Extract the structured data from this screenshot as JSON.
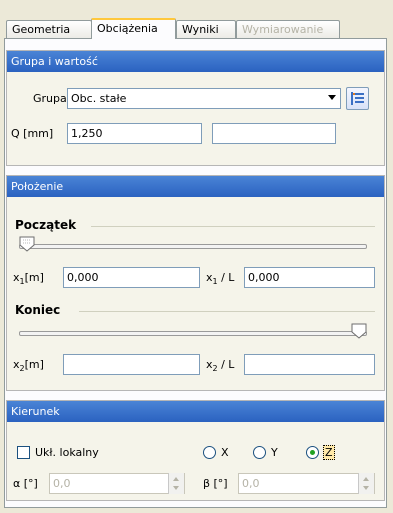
{
  "tabs": {
    "geometria": "Geometria",
    "obciazenia": "Obciążenia",
    "wyniki": "Wyniki",
    "wymiarowanie": "Wymiarowanie"
  },
  "grupa_panel": {
    "header": "Grupa i wartość",
    "grupa_label": "Grupa",
    "grupa_value": "Obc. stałe",
    "q_label": "Q [mm]",
    "q_value": "1,250",
    "q_second_value": ""
  },
  "polozenie_panel": {
    "header": "Położenie",
    "poczatek_title": "Początek",
    "poczatek_slider_value": 0.0,
    "x1_label": "x",
    "x1_sub": "1",
    "x1_unit": "[m]",
    "x1_value": "0,000",
    "x1L_label": "x",
    "x1L_sub": "1",
    "x1L_suffix": "/ L",
    "x1L_value": "0,000",
    "koniec_title": "Koniec",
    "koniec_slider_value": 1.0,
    "x2_label": "x",
    "x2_sub": "2",
    "x2_unit": "[m]",
    "x2_value": "",
    "x2L_label": "x",
    "x2L_sub": "2",
    "x2L_suffix": "/ L",
    "x2L_value": ""
  },
  "kierunek_panel": {
    "header": "Kierunek",
    "ukl_lokalny_label": "Ukł. lokalny",
    "ukl_lokalny_checked": false,
    "radio_x": "X",
    "radio_y": "Y",
    "radio_z": "Z",
    "selected_axis": "Z",
    "alpha_label": "α [°]",
    "alpha_value": "0,0",
    "beta_label": "β [°]",
    "beta_value": "0,0"
  },
  "colors": {
    "panel_header_top": "#4a84d6",
    "panel_header_bottom": "#2b62c0",
    "input_border": "#7f9db9",
    "radio_checked": "#21a121"
  },
  "icons": [
    "list-settings-icon",
    "slider-thumb-down-icon",
    "slider-thumb-up-icon",
    "spin-up-icon",
    "spin-down-icon"
  ]
}
